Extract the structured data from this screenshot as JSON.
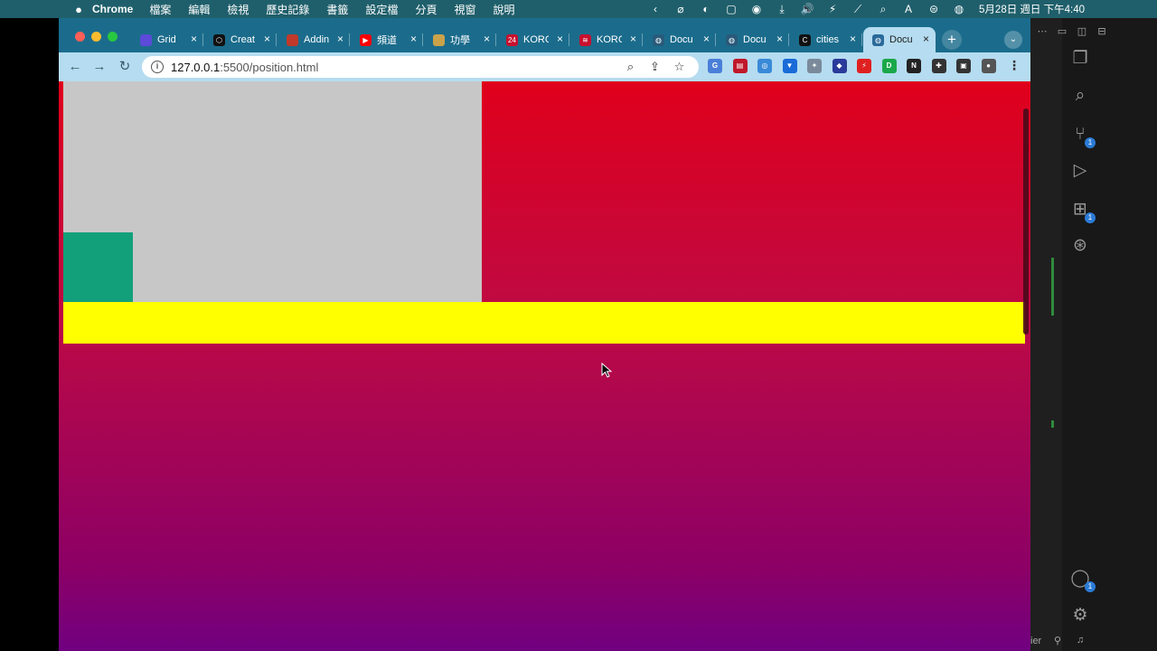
{
  "menubar": {
    "apple": "",
    "app_name": "Chrome",
    "items": [
      "檔案",
      "編輯",
      "檢視",
      "歷史記錄",
      "書籤",
      "設定檔",
      "分頁",
      "視窗",
      "說明"
    ],
    "status_icons": [
      "‹",
      "⌀",
      "◐",
      "▢",
      "◉",
      "⤓",
      "🔊",
      "⚡",
      "⟋",
      "⌕",
      "A",
      "⊜",
      "◍"
    ],
    "clock": "5月28日 週日 下午4:40"
  },
  "browser": {
    "tabs": [
      {
        "label": "Grid",
        "favicon_color": "#5b4bd8",
        "favicon_glyph": ""
      },
      {
        "label": "Creat",
        "favicon_color": "#111111",
        "favicon_glyph": "⬡"
      },
      {
        "label": "Addin",
        "favicon_color": "#c0392b",
        "favicon_glyph": ""
      },
      {
        "label": "頻道",
        "favicon_color": "#ff0000",
        "favicon_glyph": "▶"
      },
      {
        "label": "功學",
        "favicon_color": "#caa24a",
        "favicon_glyph": ""
      },
      {
        "label": "KORC",
        "favicon_color": "#c8102e",
        "favicon_glyph": "24"
      },
      {
        "label": "KORC",
        "favicon_color": "#c8102e",
        "favicon_glyph": "≋"
      },
      {
        "label": "Docu",
        "favicon_color": "#2a5a7a",
        "favicon_glyph": "◍"
      },
      {
        "label": "Docu",
        "favicon_color": "#2a5a7a",
        "favicon_glyph": "◍"
      },
      {
        "label": "cities",
        "favicon_color": "#111111",
        "favicon_glyph": "C"
      },
      {
        "label": "Docu",
        "favicon_color": "#2a6a9a",
        "favicon_glyph": "◍",
        "active": true
      }
    ],
    "new_tab_label": "+",
    "tab_search_label": "⌄",
    "back_label": "←",
    "forward_label": "→",
    "reload_label": "↻",
    "url_host": "127.0.0.1",
    "url_path": ":5500/position.html",
    "omnibox_actions": [
      "⌕",
      "⇪",
      "☆"
    ],
    "extensions": [
      {
        "color": "#4a7fd8",
        "glyph": "G"
      },
      {
        "color": "#c0182a",
        "glyph": "▤"
      },
      {
        "color": "#3a8ad8",
        "glyph": "◎"
      },
      {
        "color": "#1a6bd8",
        "glyph": "▼"
      },
      {
        "color": "#7a8a9a",
        "glyph": "✦"
      },
      {
        "color": "#2a3a9a",
        "glyph": "◆"
      },
      {
        "color": "#e02020",
        "glyph": "⚡"
      },
      {
        "color": "#1aa84a",
        "glyph": "D"
      },
      {
        "color": "#222222",
        "glyph": "N"
      },
      {
        "color": "#333333",
        "glyph": "✚"
      },
      {
        "color": "#333333",
        "glyph": "▣"
      },
      {
        "color": "#555555",
        "glyph": "●"
      }
    ],
    "menu_label": "⋮"
  },
  "page": {
    "background_gradient": [
      "#e0001b",
      "#bd0a45",
      "#8d0065",
      "#700080"
    ],
    "grey_box_color": "#c7c7c7",
    "green_box_color": "#12a07a",
    "yellow_bar_color": "#ffff00"
  },
  "vscode": {
    "top_icons": [
      "⋯",
      "▭",
      "◫",
      "⊟"
    ],
    "activity_icons": [
      {
        "name": "explorer-icon",
        "glyph": "❐"
      },
      {
        "name": "search-icon",
        "glyph": "⌕"
      },
      {
        "name": "source-control-icon",
        "glyph": "⑂",
        "badge": "1"
      },
      {
        "name": "run-debug-icon",
        "glyph": "▷"
      },
      {
        "name": "extensions-icon",
        "glyph": "⊞",
        "badge": "1"
      },
      {
        "name": "git-graph-icon",
        "glyph": "⊛"
      }
    ],
    "account_badge": "1",
    "status_text": "ier"
  }
}
